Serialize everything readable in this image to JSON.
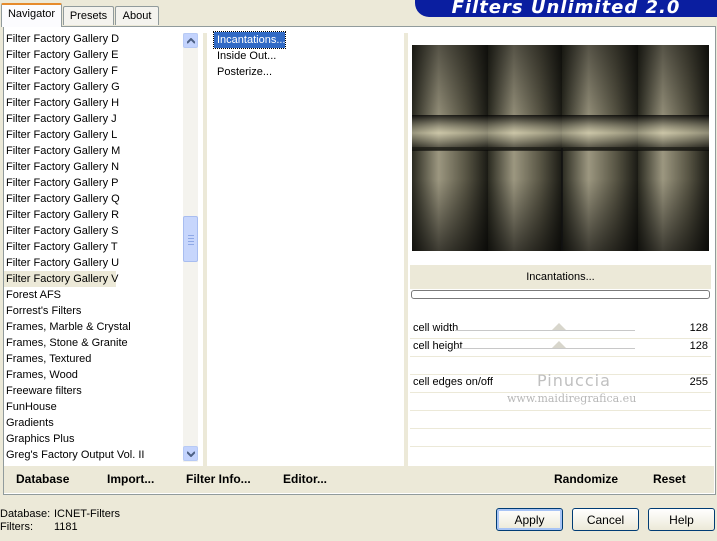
{
  "tabs": [
    "Navigator",
    "Presets",
    "About"
  ],
  "title": "Filters Unlimited 2.0",
  "categories": [
    "Filter Factory Gallery D",
    "Filter Factory Gallery E",
    "Filter Factory Gallery F",
    "Filter Factory Gallery G",
    "Filter Factory Gallery H",
    "Filter Factory Gallery J",
    "Filter Factory Gallery L",
    "Filter Factory Gallery M",
    "Filter Factory Gallery N",
    "Filter Factory Gallery P",
    "Filter Factory Gallery Q",
    "Filter Factory Gallery R",
    "Filter Factory Gallery S",
    "Filter Factory Gallery T",
    "Filter Factory Gallery U",
    "Filter Factory Gallery V",
    "Forest AFS",
    "Forrest's Filters",
    "Frames, Marble & Crystal",
    "Frames, Stone & Granite",
    "Frames, Textured",
    "Frames, Wood",
    "Freeware filters",
    "FunHouse",
    "Gradients",
    "Graphics Plus",
    "Greg's Factory Output Vol. II"
  ],
  "selected_category": "Filter Factory Gallery V",
  "filters": [
    "Incantations...",
    "Inside Out...",
    "Posterize..."
  ],
  "selected_filter": "Incantations...",
  "params": {
    "filter_name": "Incantations...",
    "rows": [
      {
        "label": "cell width",
        "value": "128"
      },
      {
        "label": "cell height",
        "value": "128"
      },
      {
        "label": "",
        "value": ""
      },
      {
        "label": "cell edges on/off",
        "value": "255"
      }
    ]
  },
  "watermark": {
    "name": "Pinuccia",
    "url": "www.maidiregrafica.eu"
  },
  "bottom_buttons": {
    "database": "Database",
    "import": "Import...",
    "filter_info": "Filter Info...",
    "editor": "Editor...",
    "randomize": "Randomize",
    "reset": "Reset"
  },
  "info": {
    "database_label": "Database:",
    "database_value": "ICNET-Filters",
    "filters_label": "Filters:",
    "filters_value": "1181"
  },
  "dialog_buttons": {
    "apply": "Apply",
    "cancel": "Cancel",
    "help": "Help"
  },
  "colors": {
    "selection": "#316ac5",
    "banner": "#0a1ea0",
    "panel_bg": "#ece9d8"
  }
}
